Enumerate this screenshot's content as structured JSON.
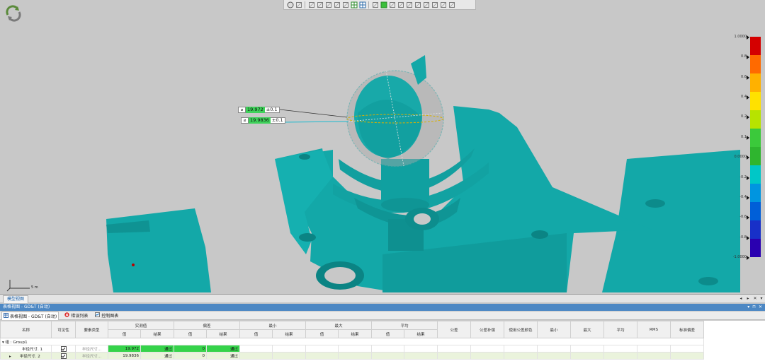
{
  "viewport": {
    "callouts": [
      {
        "symbol": "⌀",
        "value": "19.972",
        "tolerance": "±0.1"
      },
      {
        "symbol": "⌀",
        "value": "19.9836",
        "tolerance": "±0.1"
      }
    ],
    "colorbar": {
      "labels": [
        "1.0000",
        "0.8",
        "0.6",
        "0.4",
        "0.2",
        "0.1",
        "0.0000",
        "-0.2",
        "-0.4",
        "-0.6",
        "-0.8",
        "-1.0000"
      ],
      "colors": [
        "#d40000",
        "#ff6a00",
        "#ffb100",
        "#ffe100",
        "#b7e300",
        "#3bc93b",
        "#2fb52f",
        "#00c7c7",
        "#0095e0",
        "#005fd8",
        "#1830c8",
        "#2a00b0"
      ]
    },
    "scale_label": "5 m",
    "mesh_color": "#13a8a8",
    "background_color": "#c8c8c8"
  },
  "toolbar": {
    "icons": [
      "sphere-view-icon",
      "cube-icon",
      "shaded-icon",
      "front-view-icon",
      "top-view-icon",
      "side-view-icon",
      "fit-view-icon",
      "grid-icon",
      "grid-alt-icon",
      "pen-icon",
      "solid-color-icon",
      "select-icon",
      "lasso-icon",
      "brush-icon",
      "sphere-select-icon",
      "measure-icon",
      "pointer-icon",
      "connect-icon",
      "arrow-icon"
    ]
  },
  "tabstrip": {
    "model_tab": "模型视图"
  },
  "panel": {
    "title": "表格视图 - GD&T (自动)",
    "tabs": [
      {
        "label": "表格视图 - GD&T (自动)",
        "icon": "table-icon"
      },
      {
        "label": "错误列表",
        "icon": "error-icon"
      },
      {
        "label": "控制图表",
        "icon": "chart-icon"
      }
    ],
    "columns": {
      "name": "名称",
      "visibility": "可见性",
      "feature_type": "要素类型",
      "measured": "实测值",
      "deviation": "偏差",
      "min": "最小",
      "max": "最大",
      "avg": "平均",
      "value": "值",
      "result": "结果",
      "tolerance": "公差",
      "tol_comp": "公差补偿",
      "use_tol_color": "使用公差颜色",
      "min2": "最小",
      "max2": "最大",
      "avg2": "平均",
      "rms": "RMS",
      "std": "标准偏差"
    },
    "group_label": "组 : Group1",
    "rows": [
      {
        "name": "半径尺寸. 1",
        "feature_type": "半径尺寸...",
        "measured": "19.972",
        "measured_result": "通过",
        "deviation": "0",
        "deviation_result": "通过"
      },
      {
        "name": "半径尺寸. 2",
        "feature_type": "半径尺寸...",
        "measured": "19.9836",
        "measured_result": "通过",
        "deviation": "0",
        "deviation_result": "通过"
      }
    ]
  }
}
